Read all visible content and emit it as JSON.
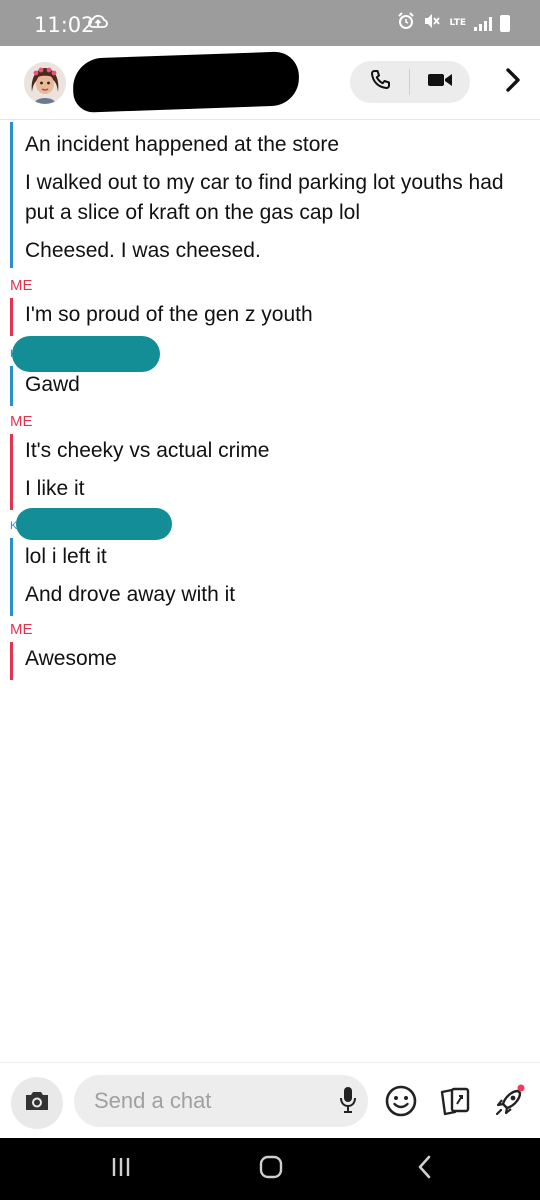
{
  "status_bar": {
    "time": "11:02",
    "network": "LTE"
  },
  "header": {
    "contact_name": "",
    "call_icon": "phone-icon",
    "video_icon": "video-camera-icon",
    "forward_icon": "chevron-right-icon"
  },
  "colors": {
    "me": "#e0344f",
    "them": "#2a8fd1",
    "redaction": "#148e96",
    "status_bar_bg": "#9c9c9c"
  },
  "messages": {
    "group1": {
      "sender": "",
      "lines": [
        "An incident happened at the store",
        "I walked out to my car to find parking lot youths had put a slice of kraft on the gas cap lol",
        "Cheesed. I was cheesed."
      ]
    },
    "group2": {
      "sender": "ME",
      "lines": [
        "I'm so proud of the gen z youth"
      ]
    },
    "group3": {
      "sender": "K",
      "lines": [
        "Gawd"
      ]
    },
    "group4": {
      "sender": "ME",
      "lines": [
        "It's cheeky vs actual crime",
        "I like it"
      ]
    },
    "group5": {
      "sender": "K",
      "lines": [
        "lol i left it",
        "And drove away with it"
      ]
    },
    "group6": {
      "sender": "ME",
      "lines": [
        "Awesome"
      ]
    }
  },
  "composer": {
    "placeholder": "Send a chat",
    "value": "",
    "camera_icon": "camera-icon",
    "mic_icon": "microphone-icon",
    "emoji_icon": "smiley-icon",
    "sticker_icon": "sticker-icon",
    "games_icon": "rocket-icon"
  },
  "nav": {
    "recents_icon": "recent-apps-icon",
    "home_icon": "home-icon",
    "back_icon": "back-icon"
  }
}
